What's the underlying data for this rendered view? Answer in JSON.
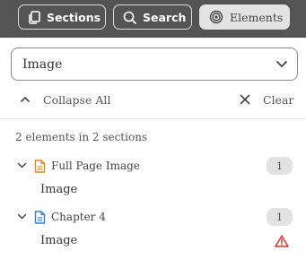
{
  "tabs": [
    {
      "label": "Sections",
      "icon": "documents-icon"
    },
    {
      "label": "Search",
      "icon": "search-icon"
    },
    {
      "label": "Elements",
      "icon": "target-icon",
      "active": true
    }
  ],
  "filter": {
    "value": "Image"
  },
  "controls": {
    "collapse_all": "Collapse All",
    "clear": "Clear"
  },
  "summary": "2 elements in 2 sections",
  "sections": [
    {
      "title": "Full Page Image",
      "count": "1",
      "icon_color": "#e08a1e",
      "elements": [
        {
          "label": "Image",
          "warning": false
        }
      ]
    },
    {
      "title": "Chapter 4",
      "count": "1",
      "icon_color": "#3a7bd5",
      "elements": [
        {
          "label": "Image",
          "warning": true
        }
      ]
    }
  ],
  "colors": {
    "topbar": "#545454",
    "warning": "#d9342b"
  }
}
